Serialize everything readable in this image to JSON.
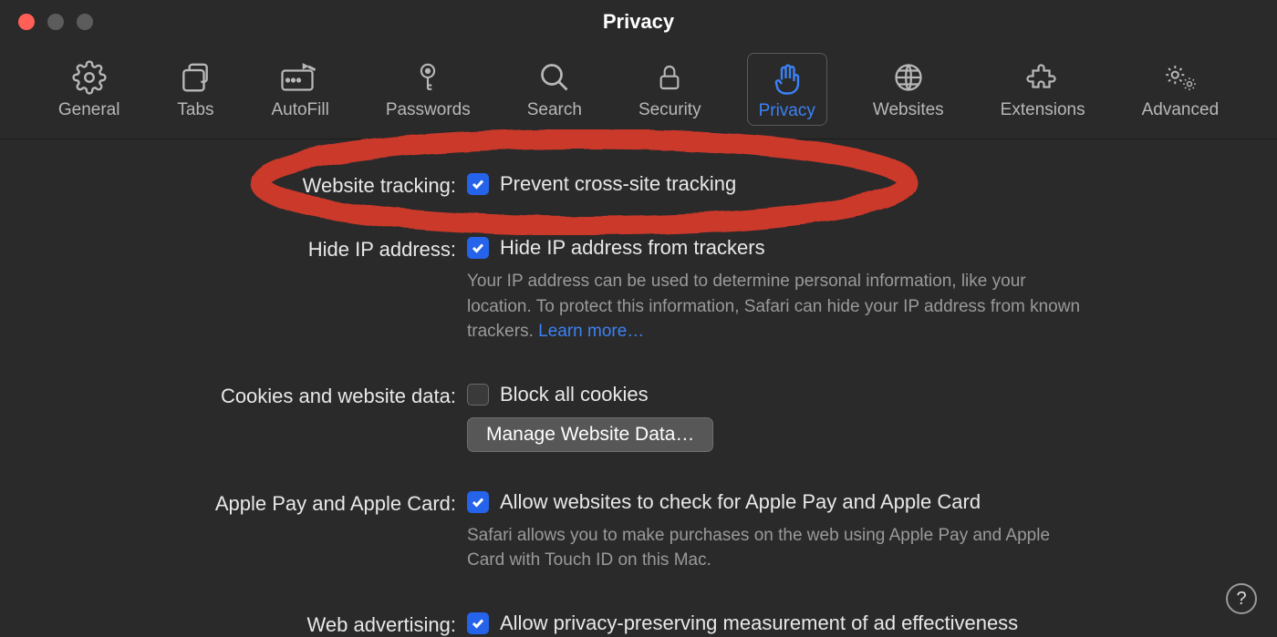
{
  "window": {
    "title": "Privacy"
  },
  "toolbar": [
    {
      "id": "general",
      "label": "General"
    },
    {
      "id": "tabs",
      "label": "Tabs"
    },
    {
      "id": "autofill",
      "label": "AutoFill"
    },
    {
      "id": "passwords",
      "label": "Passwords"
    },
    {
      "id": "search",
      "label": "Search"
    },
    {
      "id": "security",
      "label": "Security"
    },
    {
      "id": "privacy",
      "label": "Privacy",
      "active": true
    },
    {
      "id": "websites",
      "label": "Websites"
    },
    {
      "id": "extensions",
      "label": "Extensions"
    },
    {
      "id": "advanced",
      "label": "Advanced"
    }
  ],
  "sections": {
    "websiteTracking": {
      "label": "Website tracking:",
      "option": "Prevent cross-site tracking",
      "checked": true
    },
    "hideIP": {
      "label": "Hide IP address:",
      "option": "Hide IP address from trackers",
      "checked": true,
      "description": "Your IP address can be used to determine personal information, like your location. To protect this information, Safari can hide your IP address from known trackers. ",
      "learnMore": "Learn more…"
    },
    "cookies": {
      "label": "Cookies and website data:",
      "option": "Block all cookies",
      "checked": false,
      "button": "Manage Website Data…"
    },
    "applePay": {
      "label": "Apple Pay and Apple Card:",
      "option": "Allow websites to check for Apple Pay and Apple Card",
      "checked": true,
      "description": "Safari allows you to make purchases on the web using Apple Pay and Apple Card with Touch ID on this Mac."
    },
    "webAdvertising": {
      "label": "Web advertising:",
      "option": "Allow privacy-preserving measurement of ad effectiveness",
      "checked": true
    }
  },
  "helpTooltip": "?",
  "annotation": {
    "type": "hand-drawn-circle",
    "color": "#d93a2b",
    "targets": "websiteTracking row"
  }
}
